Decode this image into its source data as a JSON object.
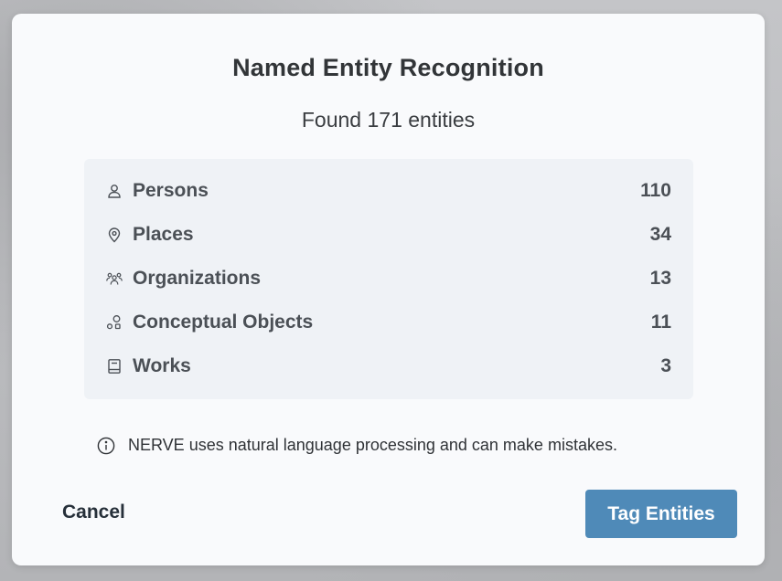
{
  "dialog": {
    "title": "Named Entity Recognition",
    "subtitle": "Found 171 entities",
    "entities": [
      {
        "icon": "person-icon",
        "label": "Persons",
        "count": "110"
      },
      {
        "icon": "map-pin-icon",
        "label": "Places",
        "count": "34"
      },
      {
        "icon": "group-icon",
        "label": "Organizations",
        "count": "13"
      },
      {
        "icon": "shapes-icon",
        "label": "Conceptual Objects",
        "count": "11"
      },
      {
        "icon": "book-icon",
        "label": "Works",
        "count": "3"
      }
    ],
    "note": {
      "icon": "info-icon",
      "text": "NERVE uses natural language processing and can make mistakes."
    },
    "cancel_label": "Cancel",
    "primary_label": "Tag Entities"
  },
  "colors": {
    "primary": "#4f8ab8",
    "panel": "#eff2f6",
    "dialog": "#f9fafc",
    "text": "#4b5056"
  }
}
